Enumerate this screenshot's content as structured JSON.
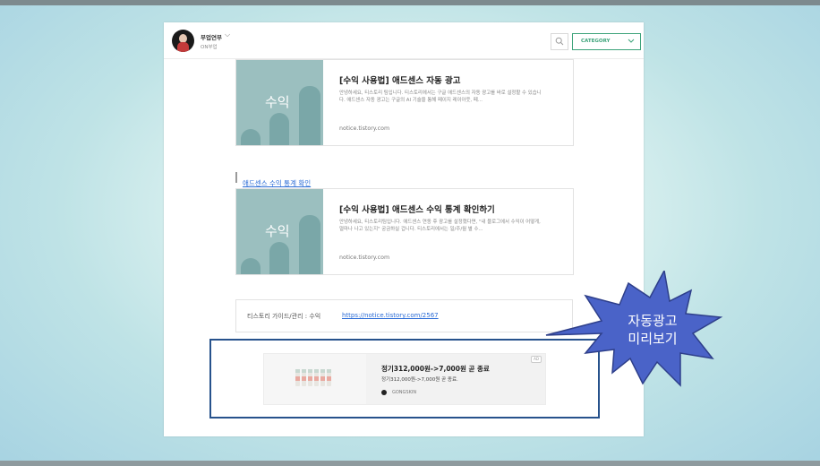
{
  "header": {
    "blog_name": "부업연부",
    "blog_subtitle": "ON부업",
    "category_label": "CATEGORY"
  },
  "cards": [
    {
      "thumb_word": "수익",
      "title": "[수익 사용법] 애드센스 자동 광고",
      "description": "안녕하세요, 티스토리 팀입니다. 티스토리에서는 구글 애드센스의 자동 광고를 바로 설정할 수 있습니다. 애드센스 자동 광고는 구글의 AI 기술을 통해 페이지 레이아웃, 페...",
      "url": "notice.tistory.com"
    },
    {
      "thumb_word": "수익",
      "title": "[수익 사용법] 애드센스 수익 통계 확인하기",
      "description": "안녕하세요, 티스토리팀입니다. 애드센스 연동 후 광고를 설정했다면, \"내 블로그에서 수익이 어떻게, 얼마나 나고 있는지\" 궁금하실 겁니다. 티스토리에서는 일/주/월 별 수...",
      "url": "notice.tistory.com"
    }
  ],
  "section_link": "애드센스 수익 통계 확인",
  "info": {
    "label": "티스토리 가이드/관리 : 수익",
    "link": "https://notice.tistory.com/2567"
  },
  "ad": {
    "title": "정기312,000원->7,000원 곧 종료",
    "subtitle": "정기312,000원->7,000원 곧 종료.",
    "brand": "GONGSKIN",
    "badge": "AD"
  },
  "callout": {
    "line1": "자동광고",
    "line2": "미리보기",
    "fill_color": "#4a63c8",
    "stroke_color": "#2e3f8a"
  },
  "colors": {
    "category_accent": "#3da37a",
    "link_blue": "#2a6bd6",
    "ad_frame": "#27528c"
  }
}
